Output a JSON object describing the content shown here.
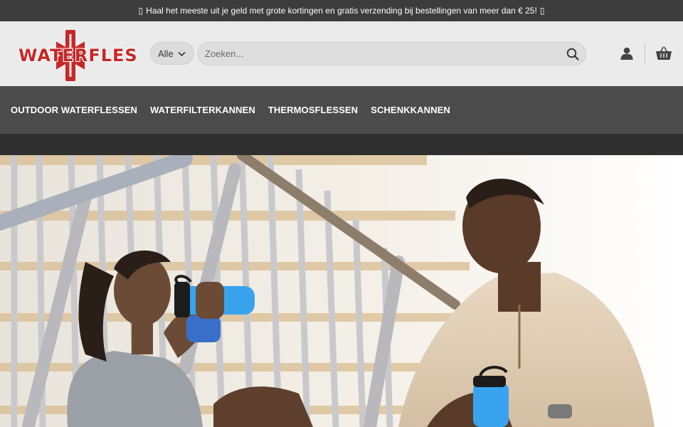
{
  "promo": {
    "icon_left": "gift-icon",
    "text": "Haal het meeste uit je geld met grote kortingen en gratis verzending bij bestellingen van meer dan € 25!",
    "icon_right": "gift-icon"
  },
  "header": {
    "logo_text": "WATERFLES",
    "category_select": {
      "value": "Alle",
      "icon": "chevron-down-icon"
    },
    "search": {
      "placeholder": "Zoeken...",
      "value": "",
      "icon": "search-icon"
    },
    "account_icon": "user-icon",
    "cart_icon": "basket-icon"
  },
  "nav": {
    "items": [
      {
        "label": "OUTDOOR WATERFLESSEN"
      },
      {
        "label": "WATERFILTERKANNEN"
      },
      {
        "label": "THERMOSFLESSEN"
      },
      {
        "label": "SCHENKKANNEN"
      }
    ]
  },
  "colors": {
    "topbar": "#3c3c3c",
    "header": "#ebebeb",
    "nav": "#4b4b4b",
    "subbar": "#2f2f2f",
    "brand_red": "#c62828"
  }
}
